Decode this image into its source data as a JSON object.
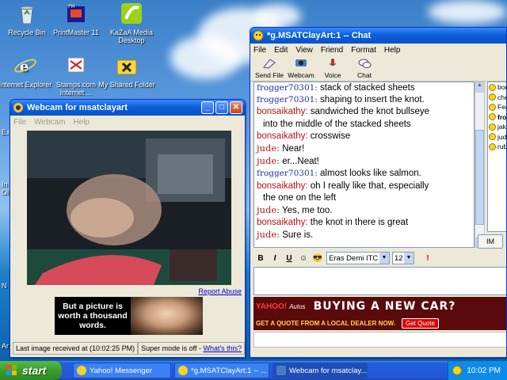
{
  "desktop": {
    "icons": [
      {
        "name": "recycle-bin-icon",
        "label": "Recycle Bin"
      },
      {
        "name": "printmaster-icon",
        "label": "PrintMaster 11"
      },
      {
        "name": "kazaa-icon",
        "label": "KaZaA Media Desktop"
      },
      {
        "name": "internet-explorer-icon",
        "label": "Internet Explorer"
      },
      {
        "name": "stamps-icon",
        "label": "Stamps.com Internet ..."
      },
      {
        "name": "shared-folder-icon",
        "label": "My Shared Folder"
      }
    ],
    "edge_labels": [
      "Ex",
      "In",
      "Oi",
      "N",
      "Ar"
    ]
  },
  "webcam": {
    "title": "Webcam for msatclayart",
    "menu": [
      "File",
      "Webcam",
      "Help"
    ],
    "report_link": "Report Abuse",
    "ad_text": "But a picture is worth a thousand words.",
    "status_left": "Last image received at (10:02:25 PM)",
    "status_right_prefix": "Super mode is off - ",
    "status_right_link": "What's this?"
  },
  "chat": {
    "title": "*g.MSATClayArt:1 -- Chat",
    "menu": [
      "File",
      "Edit",
      "View",
      "Friend",
      "Format",
      "Help"
    ],
    "tools": [
      {
        "name": "send-file",
        "label": "Send File"
      },
      {
        "name": "webcam",
        "label": "Webcam"
      },
      {
        "name": "voice",
        "label": "Voice"
      },
      {
        "name": "chat",
        "label": "Chat"
      }
    ],
    "messages": [
      {
        "who": "frogger70301:",
        "text": " stack of stacked sheets",
        "style": "f"
      },
      {
        "who": "frogger70301:",
        "text": " shaping to insert the knot.",
        "style": "f"
      },
      {
        "who": "bonsaikathy:",
        "text": " sandwiched the knot bullseye",
        "style": "b",
        "cont": "into the middle of the stacked sheets"
      },
      {
        "who": "bonsaikathy:",
        "text": " crosswise",
        "style": "b"
      },
      {
        "who": "jude:",
        "text": " Near!",
        "style": "j"
      },
      {
        "who": "jude:",
        "text": " er...Neat!",
        "style": "j"
      },
      {
        "who": "frogger70301:",
        "text": " almost looks like salmon.",
        "style": "f"
      },
      {
        "who": "bonsaikathy:",
        "text": " oh I really like that, especially",
        "style": "b",
        "cont": "the one on the left"
      },
      {
        "who": "jude:",
        "text": " Yes, me too.",
        "style": "j"
      },
      {
        "who": "bonsaikathy:",
        "text": " the knot in there is great",
        "style": "b"
      },
      {
        "who": "jude:",
        "text": " Sure is.",
        "style": "j"
      }
    ],
    "buddies": [
      "bonsa",
      "chelyh",
      "Fearle",
      "frogg",
      "jakmia",
      "jude",
      "rubens"
    ],
    "im_button": "IM",
    "font_name": "Eras Demi ITC",
    "font_size": "12",
    "ad": {
      "brand": "YAHOO!",
      "section": "Autos",
      "headline": "BUYING A NEW CAR?",
      "tagline": "GET A QUOTE FROM A LOCAL DEALER NOW.",
      "button": "Get Quote"
    }
  },
  "taskbar": {
    "start": "start",
    "tasks": [
      "Yahoo! Messenger",
      "*g.MSATClayArt:1 -- ...",
      "Webcam for msatclay..."
    ],
    "clock": "10:02 PM"
  }
}
